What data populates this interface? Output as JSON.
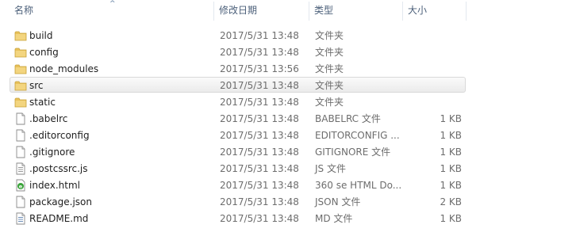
{
  "columns": {
    "name": "名称",
    "date": "修改日期",
    "type": "类型",
    "size": "大小"
  },
  "files": [
    {
      "name": "build",
      "date": "2017/5/31 13:48",
      "type": "文件夹",
      "size": "",
      "icon": "folder-icon"
    },
    {
      "name": "config",
      "date": "2017/5/31 13:48",
      "type": "文件夹",
      "size": "",
      "icon": "folder-icon"
    },
    {
      "name": "node_modules",
      "date": "2017/5/31 13:56",
      "type": "文件夹",
      "size": "",
      "icon": "folder-icon"
    },
    {
      "name": "src",
      "date": "2017/5/31 13:48",
      "type": "文件夹",
      "size": "",
      "icon": "folder-icon",
      "selected": true
    },
    {
      "name": "static",
      "date": "2017/5/31 13:48",
      "type": "文件夹",
      "size": "",
      "icon": "folder-icon"
    },
    {
      "name": ".babelrc",
      "date": "2017/5/31 13:48",
      "type": "BABELRC 文件",
      "size": "1 KB",
      "icon": "file-icon"
    },
    {
      "name": ".editorconfig",
      "date": "2017/5/31 13:48",
      "type": "EDITORCONFIG ...",
      "size": "1 KB",
      "icon": "file-icon"
    },
    {
      "name": ".gitignore",
      "date": "2017/5/31 13:48",
      "type": "GITIGNORE 文件",
      "size": "1 KB",
      "icon": "file-icon"
    },
    {
      "name": ".postcssrc.js",
      "date": "2017/5/31 13:48",
      "type": "JS 文件",
      "size": "1 KB",
      "icon": "script-file-icon"
    },
    {
      "name": "index.html",
      "date": "2017/5/31 13:48",
      "type": "360 se HTML Do...",
      "size": "1 KB",
      "icon": "html-file-icon"
    },
    {
      "name": "package.json",
      "date": "2017/5/31 13:48",
      "type": "JSON 文件",
      "size": "2 KB",
      "icon": "file-icon"
    },
    {
      "name": "README.md",
      "date": "2017/5/31 13:48",
      "type": "MD 文件",
      "size": "1 KB",
      "icon": "text-file-icon"
    }
  ],
  "colors": {
    "folder": "#e8c15a",
    "selection_border": "#d9d9d9",
    "header_text": "#4c607a",
    "html_icon": "#3aa43a"
  }
}
